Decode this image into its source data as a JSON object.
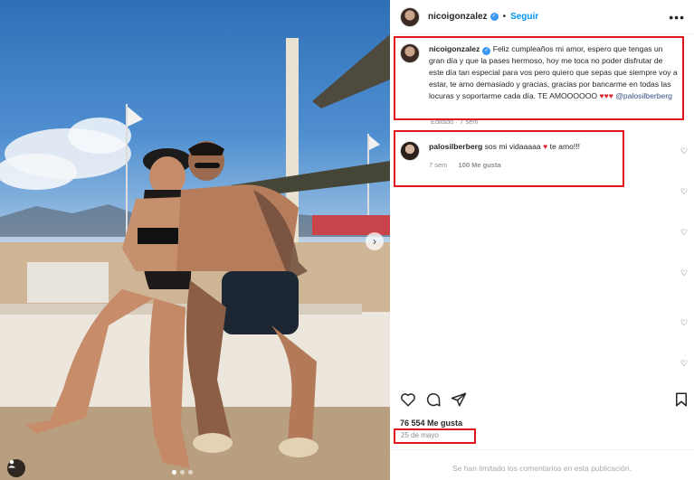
{
  "post": {
    "username": "nicoigonzalez",
    "follow_label": "Seguir",
    "bullet": "•",
    "more_label": "•••"
  },
  "caption": {
    "username": "nicoigonzalez",
    "text": "Feliz cumpleaños mi amor, espero que tengas un gran día y que la pases hermoso, hoy me toca no poder disfrutar de este día tan especial para vos pero quiero que sepas que siempre voy a estar, te amo demasiado y gracias, gracias por bancarme en todas las locuras y soportarme cada día. TE AMOOOOOO",
    "hearts": "♥♥♥",
    "mention": "@palosilberberg",
    "edited": "Editado · 7 sem"
  },
  "comment": {
    "username": "palosilberberg",
    "text": "sos mi vidaaaaa",
    "heart": "♥",
    "text_end": "te amo!!!",
    "time": "7 sem",
    "likes": "100 Me gusta"
  },
  "engagement": {
    "likes": "76 554 Me gusta",
    "date": "25 de mayo"
  },
  "footer": {
    "comments_limited": "Se han limitado los comentarios en esta publicación."
  },
  "icons": {
    "like": "heart-icon",
    "comment": "comment-icon",
    "share": "share-icon",
    "save": "bookmark-icon",
    "more": "more-options-icon",
    "next": "chevron-right-icon",
    "tagged": "user-tag-icon"
  },
  "colors": {
    "highlight_box": "#e1141b",
    "link_blue": "#0095f6",
    "verified_blue": "#3897f0",
    "heart_red": "#e0242b"
  }
}
